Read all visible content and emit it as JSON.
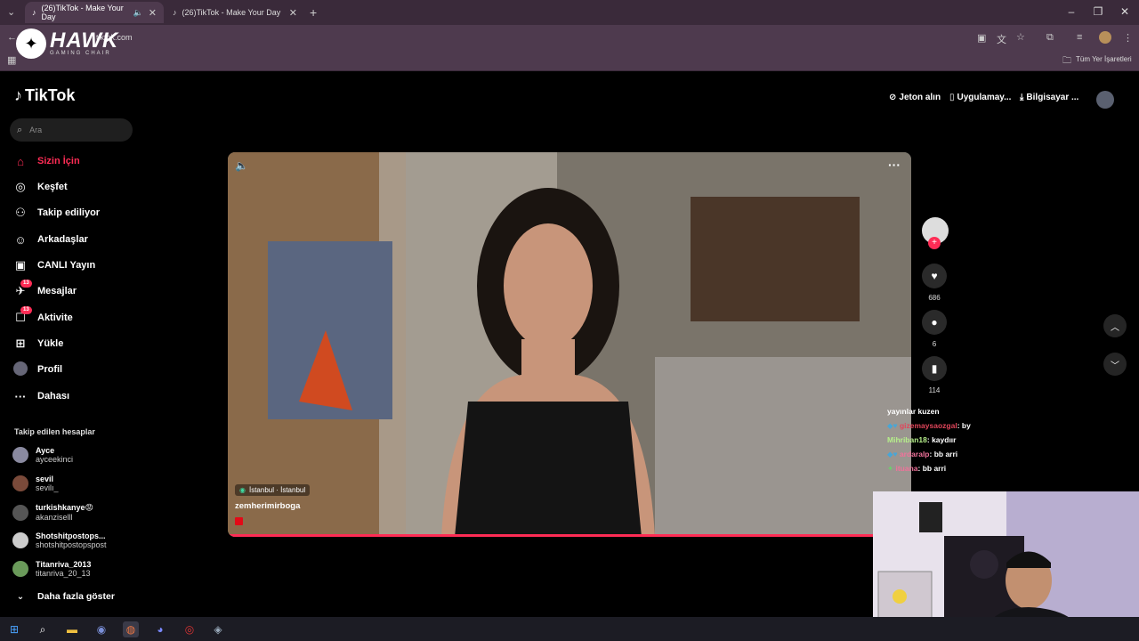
{
  "browser": {
    "tabs": [
      {
        "title": "(26)TikTok - Make Your Day"
      },
      {
        "title": "(26)TikTok - Make Your Day"
      }
    ],
    "url": "tiktok.com",
    "bookmarks_label": "Tüm Yer İşaretleri"
  },
  "logo": {
    "name": "HAWK",
    "sub": "GAMING CHAIR"
  },
  "tiktok": {
    "brand": "TikTok",
    "search_placeholder": "Ara",
    "nav": [
      {
        "label": "Sizin İçin",
        "icon": "home-icon"
      },
      {
        "label": "Keşfet",
        "icon": "compass-icon"
      },
      {
        "label": "Takip ediliyor",
        "icon": "following-icon"
      },
      {
        "label": "Arkadaşlar",
        "icon": "friends-icon"
      },
      {
        "label": "CANLI Yayın",
        "icon": "live-icon"
      },
      {
        "label": "Mesajlar",
        "icon": "messages-icon",
        "badge": "13"
      },
      {
        "label": "Aktivite",
        "icon": "activity-icon",
        "badge": "13"
      },
      {
        "label": "Yükle",
        "icon": "upload-icon"
      },
      {
        "label": "Profil",
        "icon": "profile-icon"
      },
      {
        "label": "Dahası",
        "icon": "more-icon"
      }
    ],
    "followed_heading": "Takip edilen hesaplar",
    "followed": [
      {
        "name": "Ayce",
        "handle": "ayceekinci"
      },
      {
        "name": "sevil",
        "handle": "sevilı_"
      },
      {
        "name": "turkishkanye😡",
        "handle": "akanziselll"
      },
      {
        "name": "Shotshitpostops...",
        "handle": "shotshitpostopspost"
      },
      {
        "name": "Titanriva_2013",
        "handle": "titanriva_20_13"
      }
    ],
    "show_more": "Daha fazla göster",
    "top_actions": [
      {
        "label": "Jeton alın"
      },
      {
        "label": "Uygulamay..."
      },
      {
        "label": "Bilgisayar ..."
      }
    ],
    "video": {
      "location": "İstanbul · İstanbul",
      "author": "zemherimirboga"
    },
    "counts": {
      "likes": "686",
      "comments": "6",
      "saves": "114"
    }
  },
  "chat": [
    {
      "user": "yayınlar kuzen",
      "msg": ""
    },
    {
      "user": "gizemaysaozgal",
      "msg": ": by"
    },
    {
      "user": "Mihriban18",
      "msg": ": kaydıır"
    },
    {
      "user": "ardaralp",
      "msg": ": bb arri"
    },
    {
      "user": "ituana",
      "msg": ": bb arri"
    }
  ],
  "colors": {
    "accent": "#fe2c55",
    "chrome": "#4e3a4e"
  }
}
